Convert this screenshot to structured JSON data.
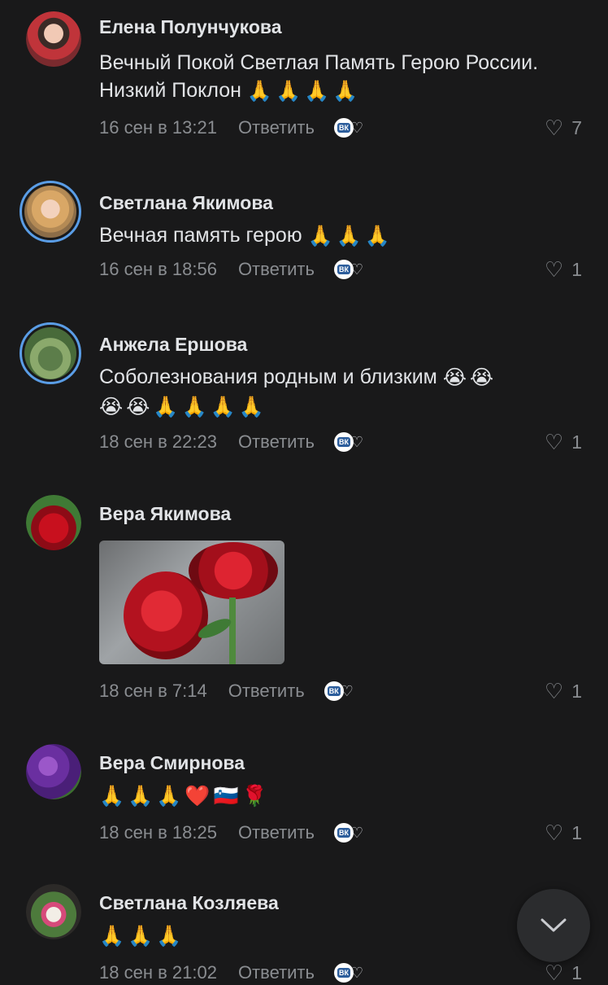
{
  "comments": [
    {
      "author": "Елена Полунчукова",
      "text": "Вечный Покой Светлая Память Герою России. Низкий Поклон",
      "emojis": "🙏🙏🙏🙏",
      "time": "16 сен в 13:21",
      "reply_label": "Ответить",
      "likes": "7",
      "avatar_icon": "avatar-girl-red"
    },
    {
      "author": "Светлана Якимова",
      "text": "Вечная память герою",
      "emojis": "🙏🙏🙏",
      "time": "16 сен в 18:56",
      "reply_label": "Ответить",
      "likes": "1",
      "avatar_icon": "avatar-woman-blonde"
    },
    {
      "author": "Анжела Ершова",
      "text": "Соболезнования родным и близким",
      "emojis_inline": "😭😭",
      "emojis_line2": "😭😭🙏🙏🙏🙏",
      "time": "18 сен в 22:23",
      "reply_label": "Ответить",
      "likes": "1",
      "avatar_icon": "avatar-park"
    },
    {
      "author": "Вера Якимова",
      "time": "18 сен в 7:14",
      "reply_label": "Ответить",
      "likes": "1",
      "avatar_icon": "avatar-red-rose",
      "photo_icon": "red-roses-photo"
    },
    {
      "author": "Вера Смирнова",
      "emojis": "🙏🙏🙏❤️🇸🇮🌹",
      "time": "18 сен в 18:25",
      "reply_label": "Ответить",
      "likes": "1",
      "avatar_icon": "avatar-purple-flowers"
    },
    {
      "author": "Светлана Козляева",
      "emojis": "🙏🙏🙏",
      "time": "18 сен в 21:02",
      "reply_label": "Ответить",
      "likes": "1",
      "avatar_icon": "avatar-flowers-white"
    }
  ],
  "reaction_badge": "ВК",
  "scroll_button_icon": "chevron-down-icon",
  "colors": {
    "background": "#19191a",
    "text_primary": "#e1e3e6",
    "text_secondary": "#8a8d91",
    "avatar_ring": "#5a9de6"
  }
}
